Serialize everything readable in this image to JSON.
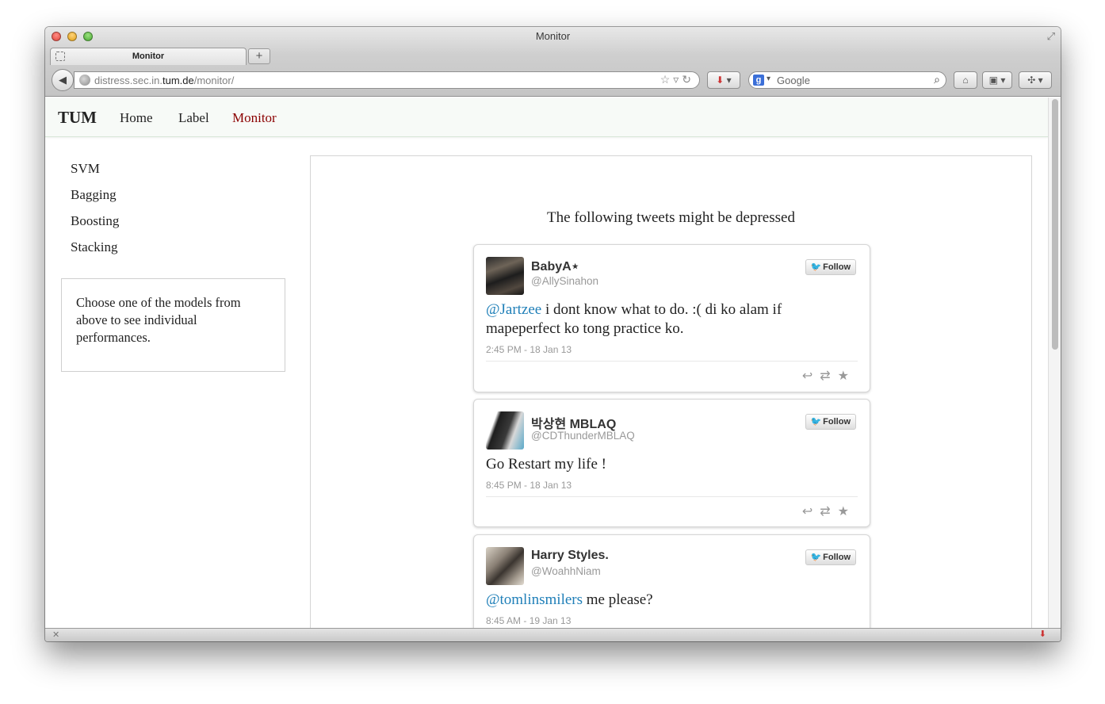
{
  "window": {
    "title": "Monitor",
    "tab_label": "Monitor",
    "new_tab_symbol": "+",
    "url_prefix": "distress.sec.in.",
    "url_domain": "tum.de",
    "url_path": "/monitor/",
    "search_placeholder": "Google",
    "search_engine_badge": "g"
  },
  "navbar": {
    "brand": "TUM",
    "links": [
      {
        "label": "Home",
        "active": false
      },
      {
        "label": "Label",
        "active": false
      },
      {
        "label": "Monitor",
        "active": true
      }
    ],
    "active_color": "#8b0000"
  },
  "sidebar": {
    "items": [
      "SVM",
      "Bagging",
      "Boosting",
      "Stacking"
    ],
    "help_text": "Choose one of the models from above to see individual performances."
  },
  "main": {
    "heading": "The following tweets might be depressed",
    "follow_label": "Follow",
    "tweets": [
      {
        "display_name": "BabyA⋆",
        "handle": "@AllySinahon",
        "mention": "@Jartzee",
        "text": " i dont know what to do. :( di ko alam if mapeperfect ko tong practice ko.",
        "time": "2:45 PM - 18 Jan 13"
      },
      {
        "display_name": "박상현 MBLAQ",
        "handle": "@CDThunderMBLAQ",
        "mention": "",
        "text": "Go Restart my life !",
        "time": "8:45 PM - 18 Jan 13"
      },
      {
        "display_name": "Harry Styles.",
        "handle": "@WoahhNiam",
        "mention": "@tomlinsmilers",
        "text": " me please?",
        "time": "8:45 AM - 19 Jan 13"
      }
    ]
  },
  "icons": {
    "reply": "reply-icon",
    "retweet": "retweet-icon",
    "favorite": "star-icon",
    "twitter_bird": "twitter-bird-icon"
  }
}
